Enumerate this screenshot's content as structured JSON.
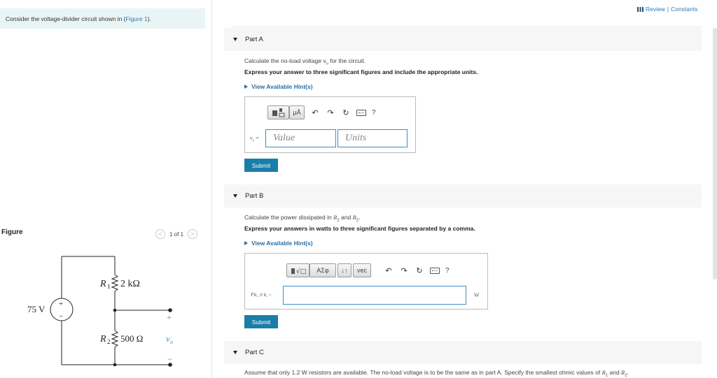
{
  "left_panel": {
    "intro_text": "Consider the voltage-divider circuit shown in (",
    "intro_link": "Figure 1",
    "intro_end": ").",
    "figure_label": "Figure",
    "pager_prev": "<",
    "pager_count": "1 of 1",
    "pager_next": ">"
  },
  "circuit": {
    "source_label": "75 V",
    "source_plus": "+",
    "source_minus": "−",
    "r1_label": "R",
    "r1_sub": "1",
    "r1_value": "2 kΩ",
    "r2_label": "R",
    "r2_sub": "2",
    "r2_value": "500 Ω",
    "vo_label": "v",
    "vo_sub": "o",
    "out_plus": "+",
    "out_minus": "−"
  },
  "header": {
    "review_label": "Review",
    "separator": "|",
    "constants_label": "Constants"
  },
  "part_a": {
    "title": "Part A",
    "prompt": "Calculate the no-load voltage v",
    "prompt_sub": "o",
    "prompt_end": " for the circuit.",
    "instruction": "Express your answer to three significant figures and include the appropriate units.",
    "hint": "View Available Hint(s)",
    "mu_button": "μÅ",
    "help": "?",
    "var_label": "v",
    "var_sub": "o",
    "var_eq": " =",
    "value_placeholder": "Value",
    "units_placeholder": "Units",
    "submit": "Submit"
  },
  "part_b": {
    "title": "Part B",
    "prompt_start": "Calculate the power dissipated in ",
    "r1": "R",
    "r1_sub": "1",
    "and": " and ",
    "r2": "R",
    "r2_sub": "2",
    "prompt_end": ".",
    "instruction": "Express your answers in watts to three significant figures separated by a comma.",
    "hint": "View Available Hint(s)",
    "sigma_button": "ΑΣφ",
    "arrows_button": "↓↑",
    "vec_button": "vec",
    "help": "?",
    "var_label": "P",
    "var_label_tail": "R₁, P R₂ =",
    "unit": "W",
    "submit": "Submit"
  },
  "part_c": {
    "title": "Part C",
    "prompt_start": "Assume that only 1.2 W resistors are available. The no-load voltage is to be the same as in part A. Specify the smallest ohmic values of ",
    "r1": "R",
    "r1_sub": "1",
    "and": " and ",
    "r2": "R",
    "r2_sub": "2",
    "prompt_end": "."
  },
  "colors": {
    "accent": "#1a7ea9",
    "link": "#2a7ab0",
    "intro_bg": "#e9f4f5",
    "part_bg": "#f6f6f6"
  }
}
